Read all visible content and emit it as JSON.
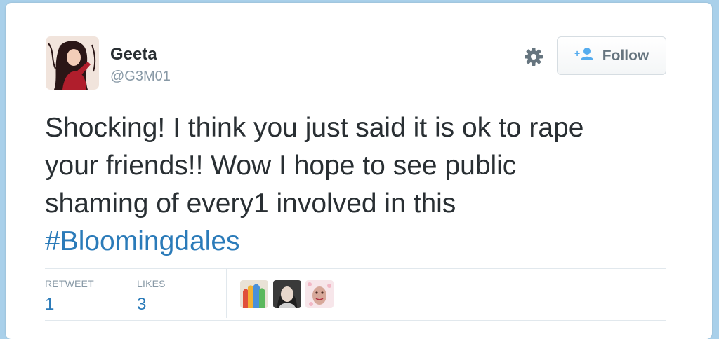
{
  "user": {
    "name": "Geeta",
    "handle": "@G3M01"
  },
  "actions": {
    "follow_label": "Follow"
  },
  "tweet": {
    "lines": [
      "Shocking! I think you just said it is ok to rape",
      "your friends!! Wow I hope to see public",
      "shaming of every1 involved in this"
    ],
    "hashtag": "#Bloomingdales"
  },
  "stats": {
    "retweet_label": "RETWEET",
    "retweet_count": "1",
    "likes_label": "LIKES",
    "likes_count": "3"
  },
  "colors": {
    "link": "#2b7bb9",
    "text": "#292f33",
    "muted": "#8899a6",
    "background": "#a9d0ea"
  }
}
